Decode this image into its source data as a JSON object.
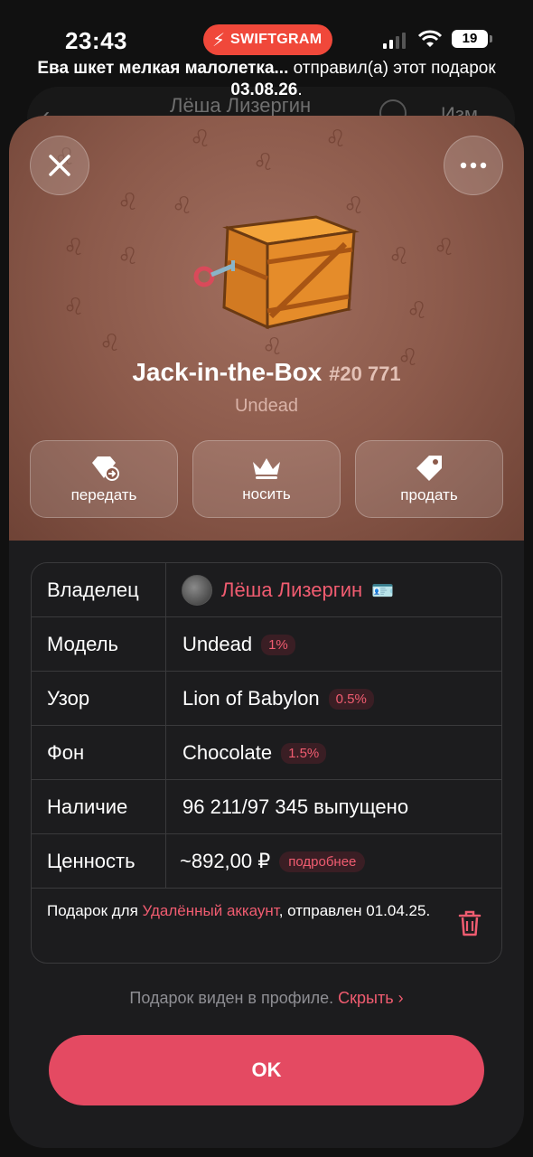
{
  "status_bar": {
    "time": "23:43",
    "app_badge": "SWIFTGRAM",
    "battery": "19",
    "accent": "#f0483a"
  },
  "background_chat": {
    "title": "Лёша Лизергин",
    "edit_label": "Изм"
  },
  "notice": {
    "sender": "Ева шкет мелкая малолетка...",
    "text_mid": " отправил(а) этот подарок ",
    "date": "03.08.26",
    "text_end": "."
  },
  "sheet": {
    "hero_color": "#8c5a4b",
    "gift_name": "Jack-in-the-Box",
    "gift_number": "#20 771",
    "gift_model": "Undead",
    "icons": {
      "close": "close-icon",
      "more": "more-icon"
    },
    "actions": [
      {
        "label": "передать",
        "icon": "transfer-gem-icon"
      },
      {
        "label": "носить",
        "icon": "crown-icon"
      },
      {
        "label": "продать",
        "icon": "price-tag-icon"
      }
    ]
  },
  "details": {
    "owner_label": "Владелец",
    "owner_name": "Лёша Лизергин",
    "model_label": "Модель",
    "model_value": "Undead",
    "model_pct": "1%",
    "pattern_label": "Узор",
    "pattern_value": "Lion of Babylon",
    "pattern_pct": "0.5%",
    "backdrop_label": "Фон",
    "backdrop_value": "Chocolate",
    "backdrop_pct": "1.5%",
    "availability_label": "Наличие",
    "availability_value": "96 211/97 345 выпущено",
    "value_label": "Ценность",
    "value_amount": "~892,00 ₽",
    "value_more": "подробнее",
    "note_prefix": "Подарок для ",
    "note_link": "Удалённый аккаунт",
    "note_suffix": ", отправлен 01.04.25."
  },
  "footer": {
    "visible_text": "Подарок виден в профиле. ",
    "hide_link": "Скрыть ›",
    "ok_label": "OK",
    "ok_color": "#e44a62"
  }
}
